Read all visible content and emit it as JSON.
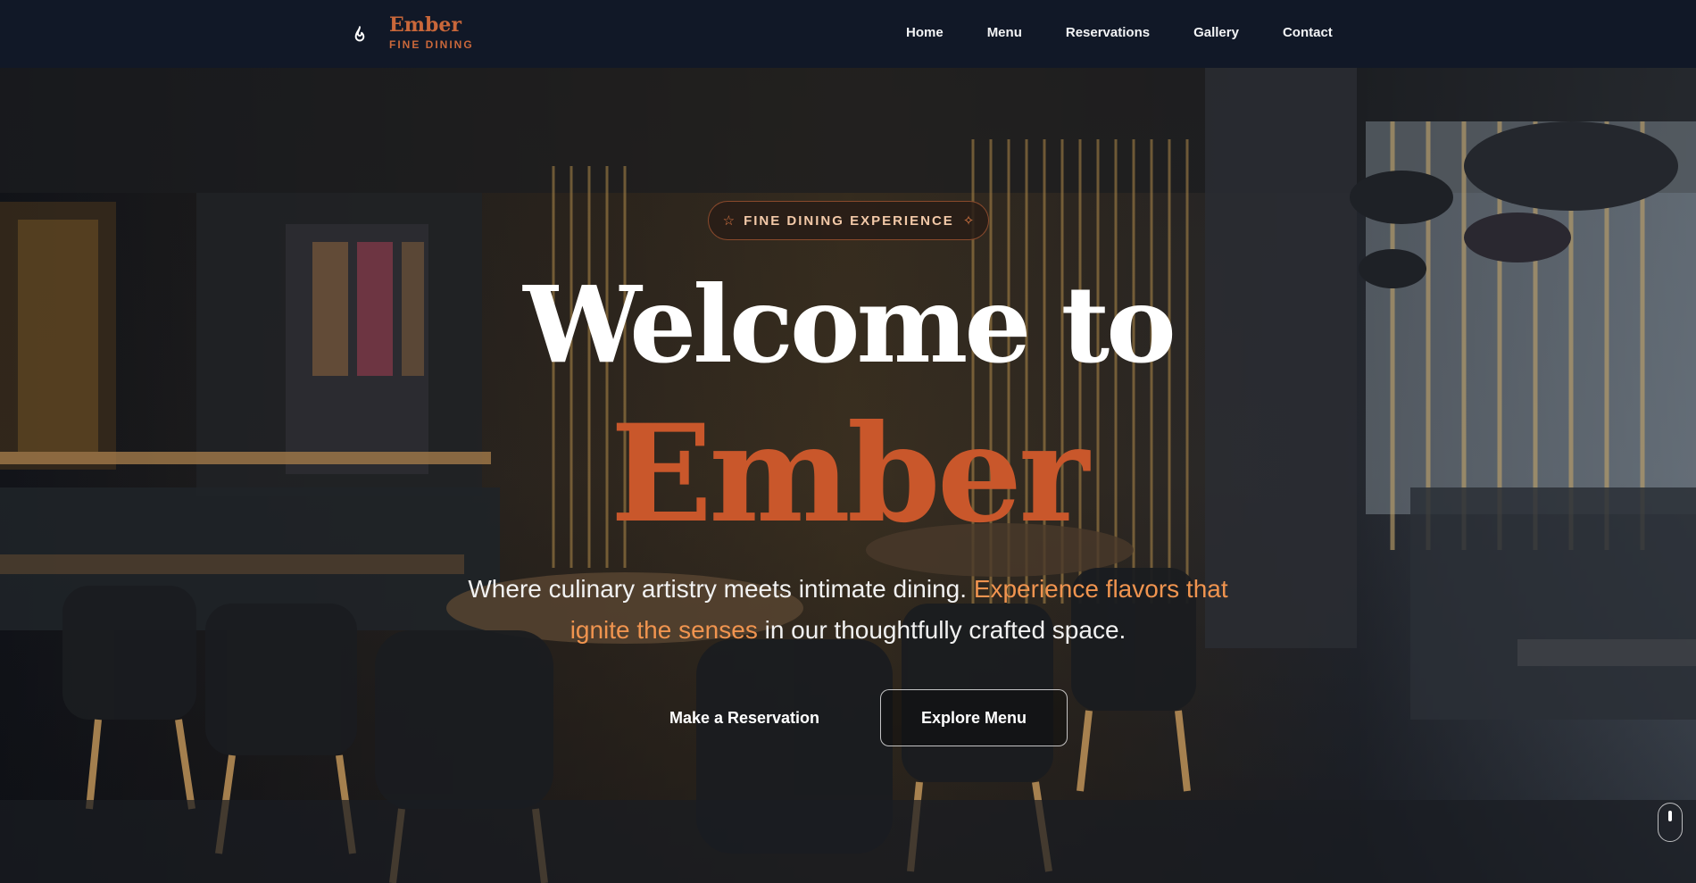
{
  "nav": {
    "brand_name": "Ember",
    "brand_tagline": "FINE DINING",
    "links": [
      "Home",
      "Menu",
      "Reservations",
      "Gallery",
      "Contact"
    ]
  },
  "hero": {
    "badge": "FINE DINING EXPERIENCE",
    "title_line1": "Welcome to",
    "title_line2": "Ember",
    "subtitle_part1": "Where culinary artistry meets intimate dining. ",
    "subtitle_highlight": "Experience flavors that ignite the senses",
    "subtitle_part2": " in our thoughtfully crafted space.",
    "primary_button": "Make a Reservation",
    "secondary_button": "Explore Menu"
  },
  "colors": {
    "accent": "#c9572b",
    "highlight": "#f0944f",
    "nav_bg": "#111827"
  },
  "icons": {
    "brand": "flame-icon",
    "badge_left": "star-icon",
    "badge_right": "sparkle-icon",
    "scroll": "mouse-scroll-icon"
  }
}
